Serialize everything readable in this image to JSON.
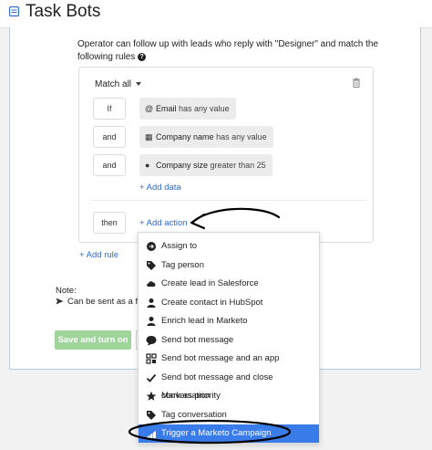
{
  "header": {
    "title": "Task Bots",
    "icon": "bot-list-icon"
  },
  "intro": {
    "text": "Operator can follow up with leads who reply with \"Designer\" and match the following rules"
  },
  "rules": {
    "match_label": "Match all",
    "conditions": [
      {
        "connector": "If",
        "icon": "at-icon",
        "attribute": "Email",
        "operator": "has any value"
      },
      {
        "connector": "and",
        "icon": "company-icon",
        "attribute": "Company name",
        "operator": "has any value"
      },
      {
        "connector": "and",
        "icon": "people-icon",
        "attribute": "Company size",
        "operator": "greater than 25"
      }
    ],
    "add_data": "+ Add data",
    "then_label": "then",
    "add_action": "+ Add action"
  },
  "add_rule": "+ Add rule",
  "note": {
    "label": "Note:",
    "text": "Can be sent as a foll"
  },
  "buttons": {
    "save": "Save and turn on"
  },
  "action_menu": {
    "items": [
      {
        "label": "Assign to",
        "icon": "assign-arrow-icon"
      },
      {
        "label": "Tag person",
        "icon": "tag-icon"
      },
      {
        "label": "Create lead in Salesforce",
        "icon": "salesforce-cloud-icon"
      },
      {
        "label": "Create contact in HubSpot",
        "icon": "person-icon"
      },
      {
        "label": "Enrich lead in Marketo",
        "icon": "person-icon"
      },
      {
        "label": "Send bot message",
        "icon": "chat-bubble-icon"
      },
      {
        "label": "Send bot message and an app",
        "icon": "app-grid-icon"
      },
      {
        "label": "Send bot message and close conversation",
        "icon": "checkmark-icon"
      },
      {
        "label": "Mark as priority",
        "icon": "star-icon"
      },
      {
        "label": "Tag conversation",
        "icon": "tag-icon"
      },
      {
        "label": "Trigger a Marketo Campaign",
        "icon": "marketo-bars-icon",
        "highlighted": true
      }
    ]
  },
  "colors": {
    "link": "#2d6bcf",
    "save_button": "#9fd49a",
    "menu_highlight": "#3a7bea",
    "panel_border": "#b9cbe4"
  }
}
